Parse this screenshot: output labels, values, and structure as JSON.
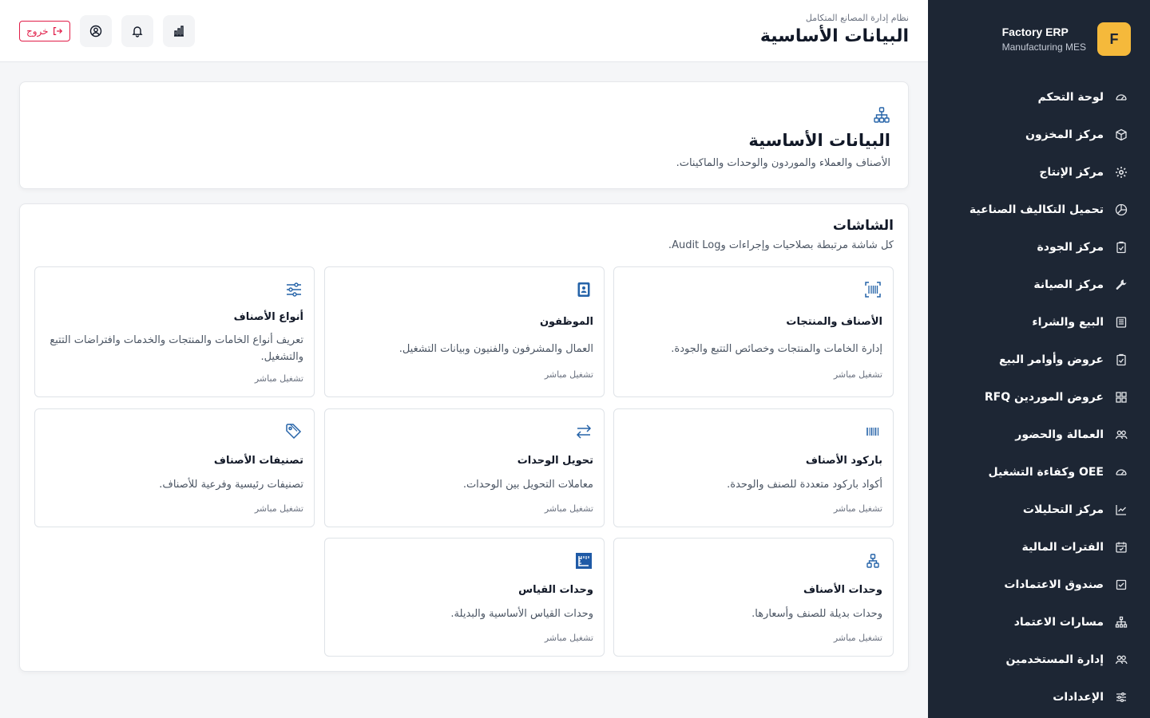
{
  "brand": {
    "logo_letter": "F",
    "name": "Factory ERP",
    "subtitle": "Manufacturing MES"
  },
  "sidebar": {
    "items": [
      {
        "label": "لوحة التحكم",
        "icon": "gauge-icon"
      },
      {
        "label": "مركز المخزون",
        "icon": "box-icon"
      },
      {
        "label": "مركز الإنتاج",
        "icon": "gear-icon"
      },
      {
        "label": "تحميل التكاليف الصناعية",
        "icon": "pie-chart-icon"
      },
      {
        "label": "مركز الجودة",
        "icon": "clipboard-check-icon"
      },
      {
        "label": "مركز الصيانة",
        "icon": "wrench-icon"
      },
      {
        "label": "البيع والشراء",
        "icon": "receipt-icon"
      },
      {
        "label": "عروض وأوامر البيع",
        "icon": "clipboard-check-icon"
      },
      {
        "label": "عروض الموردين RFQ",
        "icon": "grid-icon"
      },
      {
        "label": "العمالة والحضور",
        "icon": "users-icon"
      },
      {
        "label": "OEE وكفاءة التشغيل",
        "icon": "gauge-icon"
      },
      {
        "label": "مركز التحليلات",
        "icon": "trend-chart-icon"
      },
      {
        "label": "الفترات المالية",
        "icon": "calendar-check-icon"
      },
      {
        "label": "صندوق الاعتمادات",
        "icon": "check-square-icon"
      },
      {
        "label": "مسارات الاعتماد",
        "icon": "hierarchy-icon"
      },
      {
        "label": "إدارة المستخدمين",
        "icon": "users-icon"
      },
      {
        "label": "الإعدادات",
        "icon": "sliders-icon"
      }
    ]
  },
  "header": {
    "subtitle": "نظام إدارة المصانع المتكامل",
    "title": "البيانات الأساسية",
    "logout_label": "خروج",
    "icons": [
      "chart-icon",
      "bell-icon",
      "user-circle-icon"
    ]
  },
  "hero": {
    "title": "البيانات الأساسية",
    "description": "الأصناف والعملاء والموردون والوحدات والماكينات.",
    "icon": "hierarchy-icon"
  },
  "screens": {
    "title": "الشاشات",
    "description": "كل شاشة مرتبطة بصلاحيات وإجراءات وAudit Log.",
    "cards": [
      {
        "title": "الأصناف والمنتجات",
        "description": "إدارة الخامات والمنتجات وخصائص التتبع والجودة.",
        "run": "تشغيل مباشر",
        "icon": "barcode-scan-icon"
      },
      {
        "title": "الموظفون",
        "description": "العمال والمشرفون والفنيون وبيانات التشغيل.",
        "run": "تشغيل مباشر",
        "icon": "id-badge-icon"
      },
      {
        "title": "أنواع الأصناف",
        "description": "تعريف أنواع الخامات والمنتجات والخدمات وافتراضات التتبع والتشغيل.",
        "run": "تشغيل مباشر",
        "icon": "sliders-icon"
      },
      {
        "title": "باركود الأصناف",
        "description": "أكواد باركود متعددة للصنف والوحدة.",
        "run": "تشغيل مباشر",
        "icon": "barcode-icon"
      },
      {
        "title": "تحويل الوحدات",
        "description": "معاملات التحويل بين الوحدات.",
        "run": "تشغيل مباشر",
        "icon": "swap-arrows-icon"
      },
      {
        "title": "تصنيفات الأصناف",
        "description": "تصنيفات رئيسية وفرعية للأصناف.",
        "run": "تشغيل مباشر",
        "icon": "tag-icon"
      },
      {
        "title": "وحدات الأصناف",
        "description": "وحدات بديلة للصنف وأسعارها.",
        "run": "تشغيل مباشر",
        "icon": "hierarchy-icon"
      },
      {
        "title": "وحدات القياس",
        "description": "وحدات القياس الأساسية والبديلة.",
        "run": "تشغيل مباشر",
        "icon": "ruler-icon"
      }
    ]
  }
}
